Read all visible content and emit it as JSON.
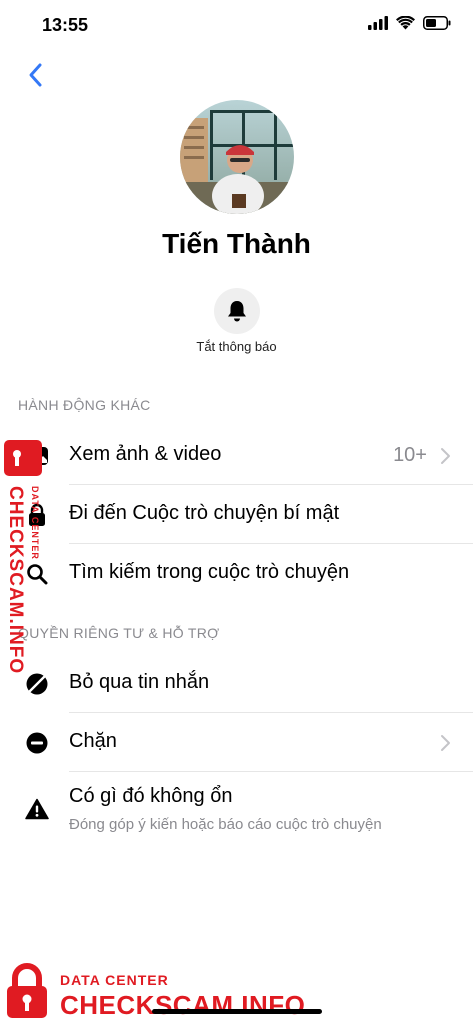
{
  "status_bar": {
    "time": "13:55"
  },
  "profile": {
    "name": "Tiến Thành"
  },
  "mute": {
    "label": "Tắt thông báo"
  },
  "section_more_actions": {
    "title": "HÀNH ĐỘNG KHÁC",
    "items": [
      {
        "label": "Xem ảnh & video",
        "value": "10+",
        "icon": "photo-icon"
      },
      {
        "label": "Đi đến Cuộc trò chuyện bí mật",
        "icon": "lock-icon"
      },
      {
        "label": "Tìm kiếm trong cuộc trò chuyện",
        "icon": "search-icon"
      }
    ]
  },
  "section_privacy": {
    "title": "QUYỀN RIÊNG TƯ & HỖ TRỢ",
    "items": [
      {
        "label": "Bỏ qua tin nhắn",
        "icon": "ignore-icon"
      },
      {
        "label": "Chặn",
        "icon": "block-icon"
      },
      {
        "label": "Có gì đó không ổn",
        "sublabel": "Đóng góp ý kiến hoặc báo cáo cuộc trò chuyện",
        "icon": "warning-icon"
      }
    ]
  },
  "watermark": {
    "small": "DATA CENTER",
    "big": "CHECKSCAM.INFO"
  },
  "colors": {
    "accent": "#3478f6",
    "watermark": "#e01b22",
    "secondary_text": "#8a8a8f"
  }
}
